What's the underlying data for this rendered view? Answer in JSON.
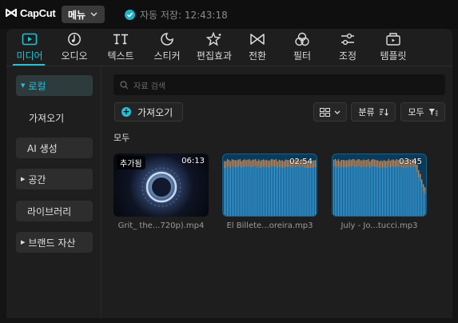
{
  "app": {
    "name": "CapCut",
    "menu_label": "메뉴",
    "autosave_text": "자동 저장: 12:43:18"
  },
  "toolbar": {
    "tabs": [
      {
        "label": "미디어",
        "icon": "media-icon",
        "active": true
      },
      {
        "label": "오디오",
        "icon": "audio-icon",
        "active": false
      },
      {
        "label": "텍스트",
        "icon": "text-icon",
        "active": false
      },
      {
        "label": "스티커",
        "icon": "sticker-icon",
        "active": false
      },
      {
        "label": "편집효과",
        "icon": "effects-icon",
        "active": false
      },
      {
        "label": "전환",
        "icon": "transition-icon",
        "active": false
      },
      {
        "label": "필터",
        "icon": "filter-icon",
        "active": false
      },
      {
        "label": "조정",
        "icon": "adjust-icon",
        "active": false
      },
      {
        "label": "템플릿",
        "icon": "template-icon",
        "active": false
      }
    ]
  },
  "sidebar": {
    "items": [
      {
        "label": "로컬",
        "expandable": true,
        "active": true
      },
      {
        "label": "가져오기",
        "expandable": false,
        "active": false
      },
      {
        "label": "AI 생성",
        "expandable": false,
        "active": false
      },
      {
        "label": "공간",
        "expandable": true,
        "active": false
      },
      {
        "label": "라이브러리",
        "expandable": false,
        "active": false
      },
      {
        "label": "브랜드 자산",
        "expandable": true,
        "active": false
      }
    ]
  },
  "main": {
    "search_placeholder": "자료 검색",
    "import_label": "가져오기",
    "sort_label": "분류",
    "filter_label": "모두",
    "section_title": "모두",
    "items": [
      {
        "type": "video",
        "badge": "추가됨",
        "duration": "06:13",
        "name": "Grit_ the...720p).mp4"
      },
      {
        "type": "audio",
        "badge": "",
        "duration": "02:54",
        "name": "El Billete...oreira.mp3"
      },
      {
        "type": "audio",
        "badge": "",
        "duration": "03:45",
        "name": "July - Jo...tucci.mp3"
      }
    ]
  },
  "colors": {
    "accent": "#22c2d6",
    "waveform": "#3aa4e6",
    "waveform_top": "#d9884a"
  }
}
